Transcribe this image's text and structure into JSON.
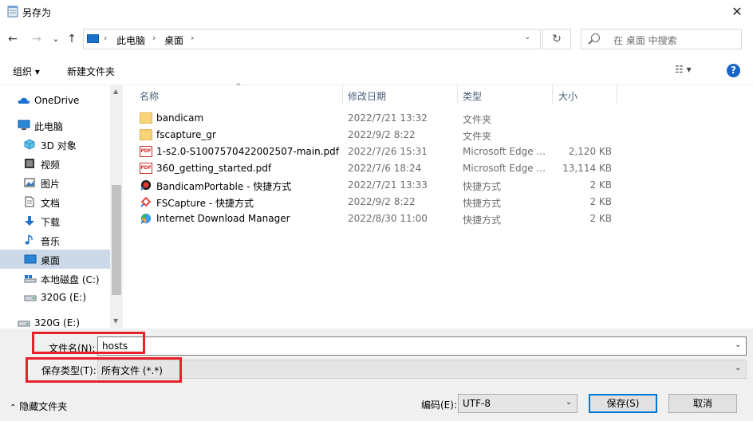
{
  "window": {
    "title": "另存为",
    "close_glyph": "✕"
  },
  "nav_buttons": {
    "back": "←",
    "forward": "→",
    "recent": "⌄",
    "up": "↑"
  },
  "address": {
    "crumbs": [
      "此电脑",
      "桌面"
    ],
    "separator": "›",
    "dropdown": "⌄",
    "refresh": "↻"
  },
  "search": {
    "placeholder": "在 桌面 中搜索",
    "icon": "search-icon"
  },
  "toolbar": {
    "organize": "组织 ▾",
    "new_folder": "新建文件夹",
    "view": "☷ ▾",
    "help": "?"
  },
  "nav_pane": {
    "items": [
      {
        "label": "OneDrive",
        "icon": "cloud-icon"
      },
      {
        "label": "此电脑",
        "icon": "computer-icon"
      },
      {
        "label": "3D 对象",
        "icon": "cube-icon"
      },
      {
        "label": "视频",
        "icon": "video-icon"
      },
      {
        "label": "图片",
        "icon": "picture-icon"
      },
      {
        "label": "文档",
        "icon": "document-icon"
      },
      {
        "label": "下载",
        "icon": "download-icon"
      },
      {
        "label": "音乐",
        "icon": "music-icon"
      },
      {
        "label": "桌面",
        "icon": "desktop-icon",
        "selected": true
      },
      {
        "label": "本地磁盘 (C:)",
        "icon": "drive-icon"
      },
      {
        "label": "320G (E:)",
        "icon": "drive-icon"
      },
      {
        "label": "320G (E:)",
        "icon": "drive-icon"
      }
    ]
  },
  "file_list": {
    "columns": [
      "名称",
      "修改日期",
      "类型",
      "大小"
    ],
    "rows": [
      {
        "name": "bandicam",
        "date": "2022/7/21 13:32",
        "type": "文件夹",
        "size": "",
        "icon": "folder-icon"
      },
      {
        "name": "fscapture_gr",
        "date": "2022/9/2 8:22",
        "type": "文件夹",
        "size": "",
        "icon": "folder-icon"
      },
      {
        "name": "1-s2.0-S1007570422002507-main.pdf",
        "date": "2022/7/26 15:31",
        "type": "Microsoft Edge ...",
        "size": "2,120 KB",
        "icon": "pdf-icon"
      },
      {
        "name": "360_getting_started.pdf",
        "date": "2022/7/6 18:24",
        "type": "Microsoft Edge ...",
        "size": "13,114 KB",
        "icon": "pdf-icon"
      },
      {
        "name": "BandicamPortable - 快捷方式",
        "date": "2022/7/21 13:33",
        "type": "快捷方式",
        "size": "2 KB",
        "icon": "bandicam-icon"
      },
      {
        "name": "FSCapture - 快捷方式",
        "date": "2022/9/2 8:22",
        "type": "快捷方式",
        "size": "2 KB",
        "icon": "fscapture-icon"
      },
      {
        "name": "Internet Download Manager",
        "date": "2022/8/30 11:00",
        "type": "快捷方式",
        "size": "2 KB",
        "icon": "idm-icon"
      }
    ]
  },
  "form": {
    "filename_label": "文件名(N):",
    "filename_value": "hosts",
    "filetype_label": "保存类型(T):",
    "filetype_value": "所有文件  (*.*)",
    "hide_folders": "隐藏文件夹",
    "encoding_label": "编码(E):",
    "encoding_value": "UTF-8",
    "save": "保存(S)",
    "cancel": "取消"
  },
  "colors": {
    "highlight": "#e8202a",
    "selection": "#ccd9e8",
    "accent": "#0078d7"
  }
}
